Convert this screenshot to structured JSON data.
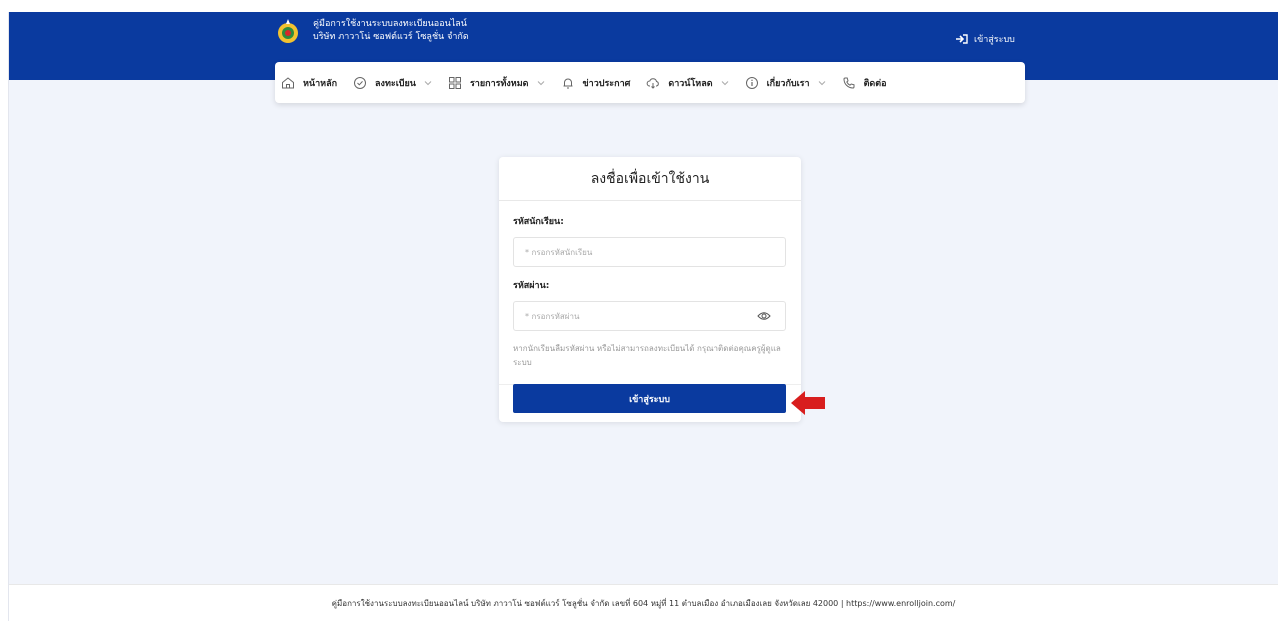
{
  "header": {
    "brand_line1": "คู่มือการใช้งานระบบลงทะเบียนออนไลน์",
    "brand_line2": "บริษัท ภาวาโน่ ซอฟต์แวร์ โซลูชั่น จำกัด",
    "login_link": "เข้าสู่ระบบ",
    "bg_color": "#0a3a9f"
  },
  "nav": {
    "items": [
      {
        "label": "หน้าหลัก",
        "icon": "home-icon"
      },
      {
        "label": "ลงทะเบียน",
        "icon": "check-circle-icon"
      },
      {
        "label": "รายการทั้งหมด",
        "icon": "grid-icon"
      },
      {
        "label": "ข่าวประกาศ",
        "icon": "bell-icon"
      },
      {
        "label": "ดาวน์โหลด",
        "icon": "cloud-download-icon"
      },
      {
        "label": "เกี่ยวกับเรา",
        "icon": "info-icon"
      },
      {
        "label": "ติดต่อ",
        "icon": "phone-icon"
      }
    ]
  },
  "login_form": {
    "title": "ลงชื่อเพื่อเข้าใช้งาน",
    "student_id_label": "รหัสนักเรียน:",
    "student_id_placeholder": "* กรอกรหัสนักเรียน",
    "student_id_value": "",
    "password_label": "รหัสผ่าน:",
    "password_placeholder": "* กรอกรหัสผ่าน",
    "password_value": "",
    "hint": "หากนักเรียนลืมรหัสผ่าน หรือไม่สามารถลงทะเบียนได้ กรุณาติดต่อคุณครูผู้ดูแลระบบ",
    "submit_label": "เข้าสู่ระบบ"
  },
  "annotation": {
    "arrow_color": "#d81e1e"
  },
  "footer": {
    "text": "คู่มือการใช้งานระบบลงทะเบียนออนไลน์ บริษัท ภาวาโน่ ซอฟต์แวร์ โซลูชั่น จำกัด เลขที่ 604 หมู่ที่ 11 ตำบลเมือง อำเภอเมืองเลย จังหวัดเลย 42000 | https://www.enrolljoin.com/"
  }
}
